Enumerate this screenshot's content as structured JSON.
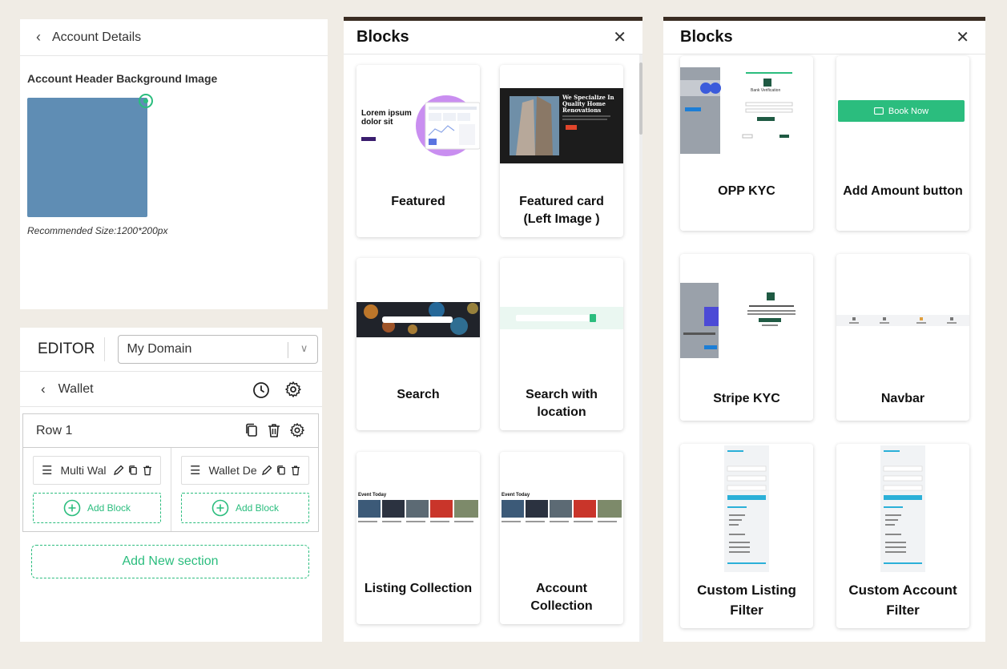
{
  "account": {
    "title": "Account Details",
    "label": "Account Header Background Image",
    "note": "Recommended Size:1200*200px",
    "image_color": "#5f8db4"
  },
  "editor": {
    "title": "EDITOR",
    "domain_select": "My Domain",
    "section": "Wallet",
    "row": {
      "label": "Row 1",
      "columns": [
        {
          "block": "Multi Wal",
          "add": "Add Block"
        },
        {
          "block": "Wallet De",
          "add": "Add Block"
        }
      ]
    },
    "add_section": "Add New section",
    "accent": "#2bbd7e"
  },
  "blocks_left": {
    "title": "Blocks",
    "cards": [
      {
        "label": "Featured",
        "thumb": {
          "heading": "Lorem ipsum dolor sit"
        }
      },
      {
        "label": "Featured card (Left Image )",
        "thumb": {
          "heading": "We Specialize In Quality Home Renovations"
        }
      },
      {
        "label": "Search"
      },
      {
        "label": "Search with location"
      },
      {
        "label": "Listing Collection",
        "thumb": {
          "heading": "Event Today"
        }
      },
      {
        "label": "Account Collection",
        "thumb": {
          "heading": "Event Today"
        }
      }
    ]
  },
  "blocks_right": {
    "title": "Blocks",
    "cards": [
      {
        "label": "OPP KYC",
        "thumb": {
          "heading": "Bank Verification"
        }
      },
      {
        "label": "Add Amount button",
        "thumb": {
          "button": "Book Now"
        }
      },
      {
        "label": "Stripe KYC"
      },
      {
        "label": "Navbar"
      },
      {
        "label": "Custom Listing Filter"
      },
      {
        "label": "Custom Account Filter"
      }
    ]
  }
}
